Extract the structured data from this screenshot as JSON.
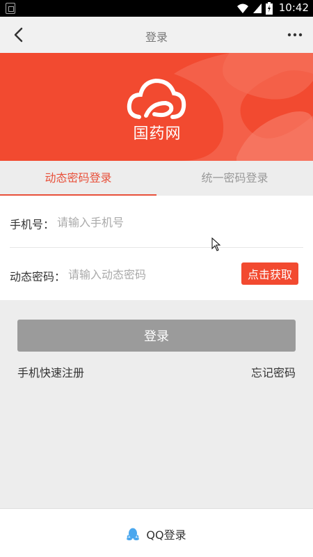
{
  "status_bar": {
    "time": "10:42"
  },
  "nav": {
    "title": "登录"
  },
  "banner": {
    "logo_text": "国药网"
  },
  "tabs": [
    {
      "label": "动态密码登录",
      "active": true
    },
    {
      "label": "统一密码登录",
      "active": false
    }
  ],
  "form": {
    "phone": {
      "label": "手机号：",
      "placeholder": "请输入手机号",
      "value": ""
    },
    "code": {
      "label": "动态密码：",
      "placeholder": "请输入动态密码",
      "value": ""
    },
    "get_code_button": "点击获取"
  },
  "login_button": "登录",
  "links": {
    "register": "手机快速注册",
    "forgot": "忘记密码"
  },
  "footer": {
    "qq_login": "QQ登录"
  },
  "colors": {
    "accent": "#f24a30",
    "tab_active": "#e8503a",
    "disabled_button": "#9b9b9b"
  }
}
